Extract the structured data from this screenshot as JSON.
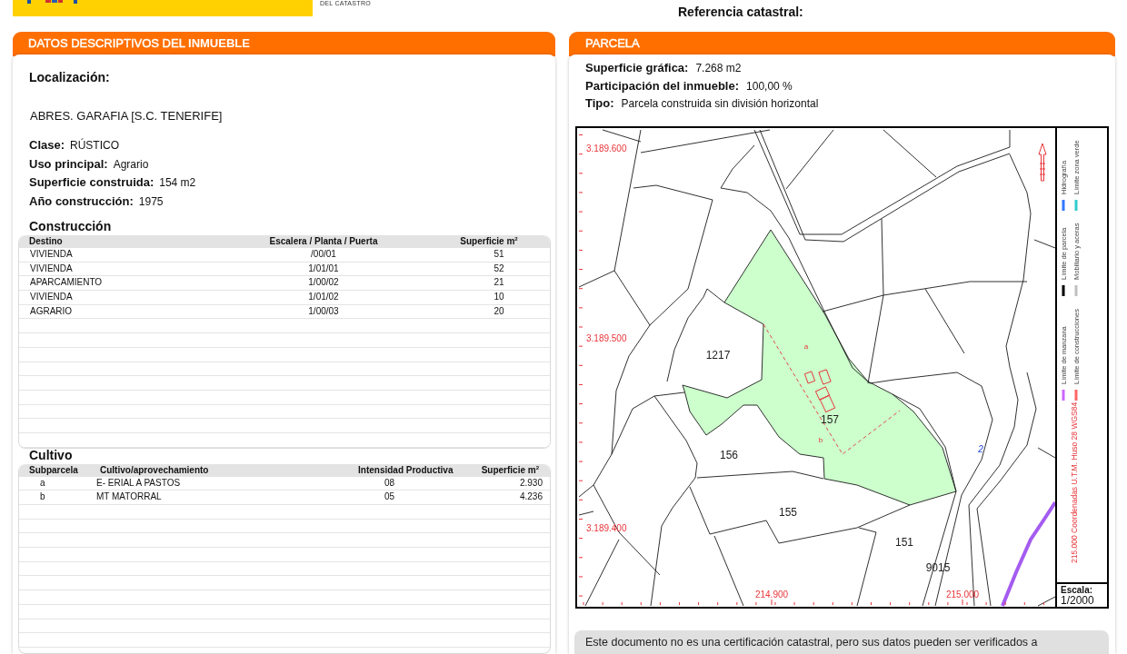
{
  "header": {
    "logo_caption": "DEL CATASTRO",
    "reference_label": "Referencia catastral:"
  },
  "property_panel": {
    "title": "DATOS DESCRIPTIVOS DEL **INMUEBLE**",
    "location_label": "Localización:",
    "address": "ABRES. GARAFIA [S.C. TENERIFE]",
    "fields": [
      {
        "label": "Clase:",
        "value": "RÚSTICO"
      },
      {
        "label": "Uso principal:",
        "value": "Agrario"
      },
      {
        "label": "Superficie construida:",
        "value": "154 m2"
      },
      {
        "label": "Año construcción:",
        "value": "1975"
      }
    ],
    "construction": {
      "title": "Construcción",
      "columns": [
        "Destino",
        "Escalera / Planta / Puerta",
        "Superficie m$^{2}$"
      ],
      "rows": [
        [
          "VIVIENDA",
          "/00/01",
          "51"
        ],
        [
          "VIVIENDA",
          "1/01/01",
          "52"
        ],
        [
          "APARCAMIENTO",
          "1/00/02",
          "21"
        ],
        [
          "VIVIENDA",
          "1/01/02",
          "10"
        ],
        [
          "AGRARIO",
          "1/00/03",
          "20"
        ]
      ]
    },
    "cultivation": {
      "title": "Cultivo",
      "columns": [
        "Subparcela",
        "Cultivo/aprovechamiento",
        "Intensidad Productiva",
        "Superficie m$^{2}$"
      ],
      "rows": [
        [
          "a",
          "E- ERIAL A PASTOS",
          "08",
          "2.930"
        ],
        [
          "b",
          "MT MATORRAL",
          "05",
          "4.236"
        ]
      ]
    }
  },
  "parcel_panel": {
    "title": "PARCELA",
    "fields": [
      {
        "label": "Superficie gráfica:",
        "value": "7.268 m2"
      },
      {
        "label": "Participación del inmueble:",
        "value": "100,00 %"
      },
      {
        "label": "Tipo:",
        "value": "Parcela construida sin división horizontal"
      }
    ],
    "map": {
      "northing_labels": [
        "3.189.600",
        "3.189.500",
        "3.189.400"
      ],
      "easting_labels": [
        "214.900",
        "215.000"
      ],
      "parcel_numbers": [
        "1217",
        "157",
        "156",
        "155",
        "151",
        "9015"
      ],
      "subparcel_letters": [
        "a",
        "b"
      ],
      "water_labels": [
        "2"
      ],
      "legend": [
        {
          "label": "Límite de manzana",
          "color": "#cc66ff"
        },
        {
          "label": "Límite de construcciones",
          "color": "#ff6666"
        },
        {
          "label": "Límite de parcela",
          "color": "#000000"
        },
        {
          "label": "Mobiliario y aceras",
          "color": "#c0c0c0"
        },
        {
          "label": "Hidrografía",
          "color": "#3377ff"
        },
        {
          "label": "Límite zona verde",
          "color": "#33cccc"
        }
      ],
      "projection_note": "215.000 Coordenadas U.T.M. Huso 28 WGS84",
      "scale_label": "Escala:",
      "scale_value": "1/2000"
    }
  },
  "notice": "Este documento no es una certificación catastral, pero sus datos pueden ser verificados a"
}
